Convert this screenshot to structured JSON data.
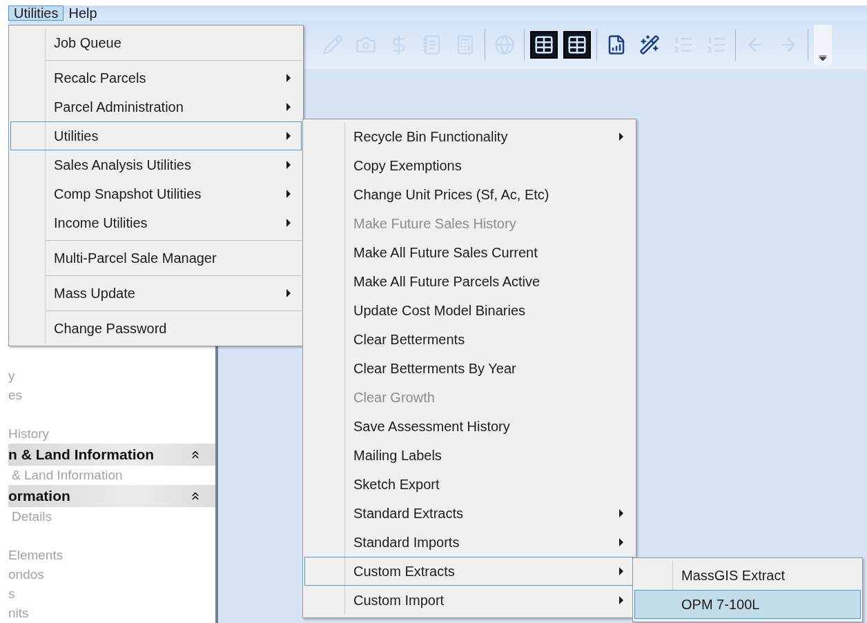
{
  "menubar": [
    {
      "label": "Utilities",
      "selected": true
    },
    {
      "label": "Help",
      "selected": false
    }
  ],
  "toolbar": [
    {
      "kind": "pencil",
      "disabled": true
    },
    {
      "kind": "camera",
      "disabled": true
    },
    {
      "kind": "dollar",
      "disabled": true
    },
    {
      "kind": "notes",
      "disabled": true
    },
    {
      "kind": "calculator",
      "disabled": true
    },
    {
      "kind": "separator"
    },
    {
      "kind": "globe",
      "disabled": true
    },
    {
      "kind": "separator"
    },
    {
      "kind": "grid",
      "disabled": false
    },
    {
      "kind": "grid",
      "disabled": false
    },
    {
      "kind": "separator"
    },
    {
      "kind": "report",
      "disabled": false
    },
    {
      "kind": "wizard",
      "disabled": false
    },
    {
      "kind": "list",
      "disabled": true
    },
    {
      "kind": "list",
      "disabled": true
    },
    {
      "kind": "separator"
    },
    {
      "kind": "back",
      "disabled": true
    },
    {
      "kind": "forward",
      "disabled": true
    },
    {
      "kind": "separator"
    },
    {
      "kind": "overflow"
    }
  ],
  "sidebar": [
    {
      "kind": "item",
      "label": "y"
    },
    {
      "kind": "item",
      "label": "es"
    },
    {
      "kind": "item",
      "label": "History",
      "blank_before": true
    },
    {
      "kind": "header",
      "label": "n & Land Information"
    },
    {
      "kind": "subitem",
      "label": "& Land Information"
    },
    {
      "kind": "header",
      "label": "ormation"
    },
    {
      "kind": "subitem",
      "label": "Details"
    },
    {
      "kind": "item",
      "label": "Elements",
      "blank_before": true
    },
    {
      "kind": "item",
      "label": "ondos"
    },
    {
      "kind": "item",
      "label": "s"
    },
    {
      "kind": "item",
      "label": "nits"
    }
  ],
  "menus": [
    {
      "items": [
        {
          "kind": "item",
          "label": "Job Queue",
          "submenu": false,
          "disabled": false,
          "selected": false,
          "expanded": false
        },
        {
          "kind": "separator"
        },
        {
          "kind": "item",
          "label": "Recalc Parcels",
          "submenu": true,
          "disabled": false,
          "selected": false,
          "expanded": false
        },
        {
          "kind": "item",
          "label": "Parcel Administration",
          "submenu": true,
          "disabled": false,
          "selected": false,
          "expanded": false
        },
        {
          "kind": "item",
          "label": "Utilities",
          "submenu": true,
          "disabled": false,
          "selected": false,
          "expanded": true
        },
        {
          "kind": "item",
          "label": "Sales Analysis Utilities",
          "submenu": true,
          "disabled": false,
          "selected": false,
          "expanded": false
        },
        {
          "kind": "item",
          "label": "Comp Snapshot Utilities",
          "submenu": true,
          "disabled": false,
          "selected": false,
          "expanded": false
        },
        {
          "kind": "item",
          "label": "Income Utilities",
          "submenu": true,
          "disabled": false,
          "selected": false,
          "expanded": false
        },
        {
          "kind": "separator"
        },
        {
          "kind": "item",
          "label": "Multi-Parcel Sale Manager",
          "submenu": false,
          "disabled": false,
          "selected": false,
          "expanded": false
        },
        {
          "kind": "separator"
        },
        {
          "kind": "item",
          "label": "Mass Update",
          "submenu": true,
          "disabled": false,
          "selected": false,
          "expanded": false
        },
        {
          "kind": "separator"
        },
        {
          "kind": "item",
          "label": "Change Password",
          "submenu": false,
          "disabled": false,
          "selected": false,
          "expanded": false
        }
      ]
    },
    {
      "items": [
        {
          "kind": "item",
          "label": "Recycle Bin Functionality",
          "submenu": true,
          "disabled": false,
          "selected": false,
          "expanded": false
        },
        {
          "kind": "item",
          "label": "Copy Exemptions",
          "submenu": false,
          "disabled": false,
          "selected": false,
          "expanded": false
        },
        {
          "kind": "item",
          "label": "Change Unit Prices (Sf, Ac, Etc)",
          "submenu": false,
          "disabled": false,
          "selected": false,
          "expanded": false
        },
        {
          "kind": "item",
          "label": "Make Future Sales History",
          "submenu": false,
          "disabled": true,
          "selected": false,
          "expanded": false
        },
        {
          "kind": "item",
          "label": "Make All Future Sales Current",
          "submenu": false,
          "disabled": false,
          "selected": false,
          "expanded": false
        },
        {
          "kind": "item",
          "label": "Make All Future Parcels Active",
          "submenu": false,
          "disabled": false,
          "selected": false,
          "expanded": false
        },
        {
          "kind": "item",
          "label": "Update Cost Model Binaries",
          "submenu": false,
          "disabled": false,
          "selected": false,
          "expanded": false
        },
        {
          "kind": "item",
          "label": "Clear Betterments",
          "submenu": false,
          "disabled": false,
          "selected": false,
          "expanded": false
        },
        {
          "kind": "item",
          "label": "Clear Betterments By Year",
          "submenu": false,
          "disabled": false,
          "selected": false,
          "expanded": false
        },
        {
          "kind": "item",
          "label": "Clear Growth",
          "submenu": false,
          "disabled": true,
          "selected": false,
          "expanded": false
        },
        {
          "kind": "item",
          "label": "Save Assessment History",
          "submenu": false,
          "disabled": false,
          "selected": false,
          "expanded": false
        },
        {
          "kind": "item",
          "label": "Mailing Labels",
          "submenu": false,
          "disabled": false,
          "selected": false,
          "expanded": false
        },
        {
          "kind": "item",
          "label": "Sketch Export",
          "submenu": false,
          "disabled": false,
          "selected": false,
          "expanded": false
        },
        {
          "kind": "item",
          "label": "Standard Extracts",
          "submenu": true,
          "disabled": false,
          "selected": false,
          "expanded": false
        },
        {
          "kind": "item",
          "label": "Standard Imports",
          "submenu": true,
          "disabled": false,
          "selected": false,
          "expanded": false
        },
        {
          "kind": "item",
          "label": "Custom Extracts",
          "submenu": true,
          "disabled": false,
          "selected": false,
          "expanded": true
        },
        {
          "kind": "item",
          "label": "Custom Import",
          "submenu": true,
          "disabled": false,
          "selected": false,
          "expanded": false
        }
      ]
    },
    {
      "items": [
        {
          "kind": "item",
          "label": "MassGIS Extract",
          "submenu": false,
          "disabled": false,
          "selected": false,
          "expanded": false
        },
        {
          "kind": "item",
          "label": "OPM 7-100L",
          "submenu": false,
          "disabled": false,
          "selected": true,
          "expanded": false
        }
      ]
    }
  ]
}
